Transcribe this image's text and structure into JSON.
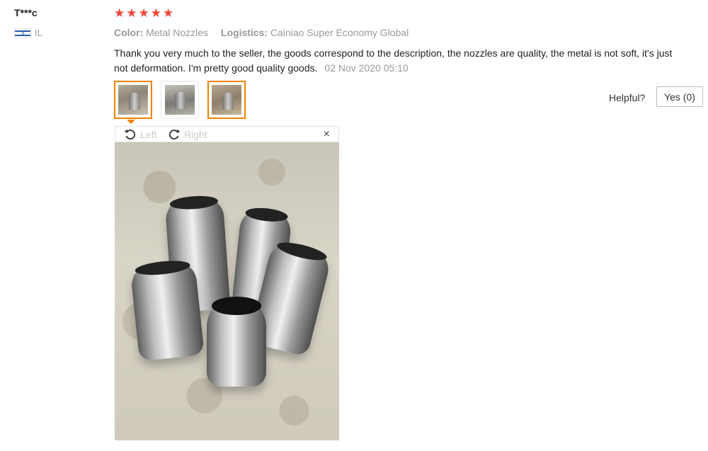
{
  "review": {
    "user": "T***c",
    "country": "IL",
    "rating": 5,
    "stars": [
      "★",
      "★",
      "★",
      "★",
      "★"
    ],
    "color_label": "Color:",
    "color_value": "Metal Nozzles",
    "logistics_label": "Logistics:",
    "logistics_value": "Cainiao Super Economy Global",
    "text": "Thank you very much to the seller, the goods correspond to the description, the nozzles are quality, the metal is not soft, it's just not deformation. I'm pretty good quality goods.",
    "date": "02 Nov 2020 05:10"
  },
  "viewer": {
    "left_label": "Left",
    "right_label": "Right",
    "close_glyph": "×"
  },
  "helpful": {
    "label": "Helpful?",
    "yes_label": "Yes (0)"
  },
  "icons": {
    "flag": "israel-flag-icon",
    "rotate_left": "rotate-left-icon",
    "rotate_right": "rotate-right-icon",
    "close": "close-icon",
    "star": "star-icon"
  },
  "colors": {
    "star": "#f44336",
    "selected_border": "#f08200",
    "muted_text": "#999999"
  }
}
